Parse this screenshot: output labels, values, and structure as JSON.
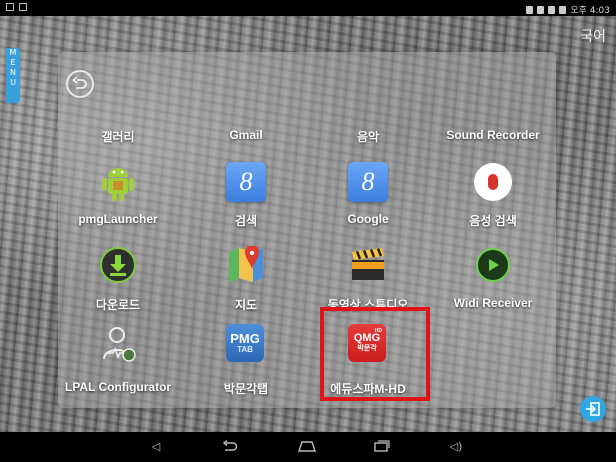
{
  "status": {
    "time": "오후 4:03"
  },
  "lang_button": "국어",
  "menu_tab": [
    "M",
    "E",
    "N",
    "U"
  ],
  "apps": [
    {
      "label": "갤러리"
    },
    {
      "label": "Gmail"
    },
    {
      "label": "음악"
    },
    {
      "label": "Sound Recorder"
    },
    {
      "label": "pmgLauncher",
      "icon": "android-icon"
    },
    {
      "label": "검색",
      "icon": "google-search-icon",
      "glyph": "8"
    },
    {
      "label": "Google",
      "icon": "google-icon",
      "glyph": "8"
    },
    {
      "label": "음성 검색",
      "icon": "microphone-icon"
    },
    {
      "label": "다운로드",
      "icon": "download-icon"
    },
    {
      "label": "지도",
      "icon": "maps-icon"
    },
    {
      "label": "동영상 스튜디오",
      "icon": "movie-studio-icon"
    },
    {
      "label": "Widi Receiver",
      "icon": "play-icon"
    },
    {
      "label": "LPAL Configurator",
      "icon": "user-config-icon"
    },
    {
      "label": "박문각탭",
      "icon": "pmg-tab-icon",
      "text1": "PMG",
      "text2": "TAB"
    },
    {
      "label": "에듀스파M-HD",
      "icon": "eduspa-icon",
      "text1": "QMG",
      "text2": "박문각",
      "text3": "HD"
    }
  ],
  "colors": {
    "highlight": "#e0131b",
    "menu_tab": "#3aa0dc",
    "float_button": "#32a6e0"
  }
}
